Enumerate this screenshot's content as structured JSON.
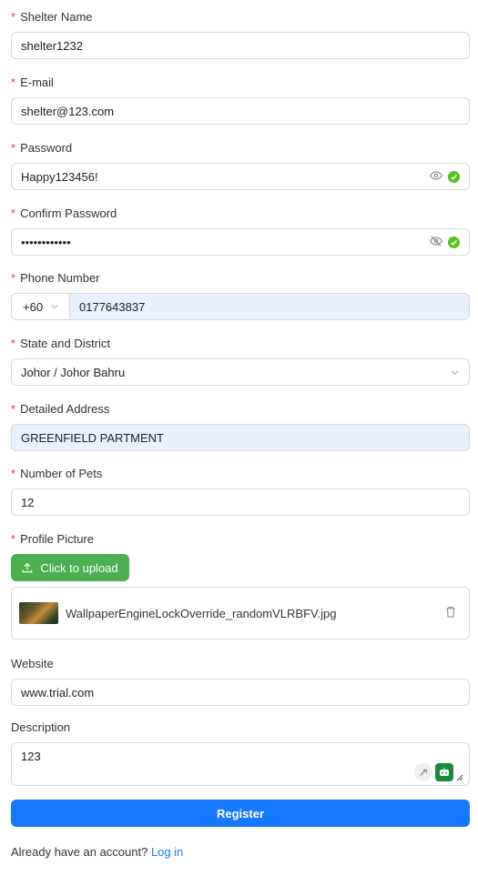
{
  "form": {
    "shelter_name": {
      "label": "Shelter Name",
      "value": "shelter1232"
    },
    "email": {
      "label": "E-mail",
      "value": "shelter@123.com"
    },
    "password": {
      "label": "Password",
      "value": "Happy123456!"
    },
    "confirm_password": {
      "label": "Confirm Password",
      "value": "••••••••••••"
    },
    "phone": {
      "label": "Phone Number",
      "code": "+60",
      "value": "0177643837"
    },
    "state": {
      "label": "State and District",
      "value": "Johor / Johor Bahru"
    },
    "address": {
      "label": "Detailed Address",
      "value": "GREENFIELD PARTMENT"
    },
    "pets": {
      "label": "Number of Pets",
      "value": "12"
    },
    "profile": {
      "label": "Profile Picture",
      "upload_label": "Click to upload",
      "file_name": "WallpaperEngineLockOverride_randomVLRBFV.jpg"
    },
    "website": {
      "label": "Website",
      "value": "www.trial.com"
    },
    "description": {
      "label": "Description",
      "value": "123"
    },
    "required_mark": "*"
  },
  "actions": {
    "register_label": "Register"
  },
  "footer": {
    "prompt": "Already have an account?",
    "login_label": "Log in"
  },
  "colors": {
    "primary": "#1677ff",
    "upload": "#4caf50",
    "required": "#e53935",
    "valid": "#52c41a",
    "autofill": "#e8f0fe"
  },
  "icons": [
    "eye-icon",
    "eye-off-icon",
    "check-circle-icon",
    "chevron-down-icon",
    "upload-icon",
    "trash-icon",
    "quill-icon",
    "bot-icon",
    "resize-handle-icon"
  ]
}
